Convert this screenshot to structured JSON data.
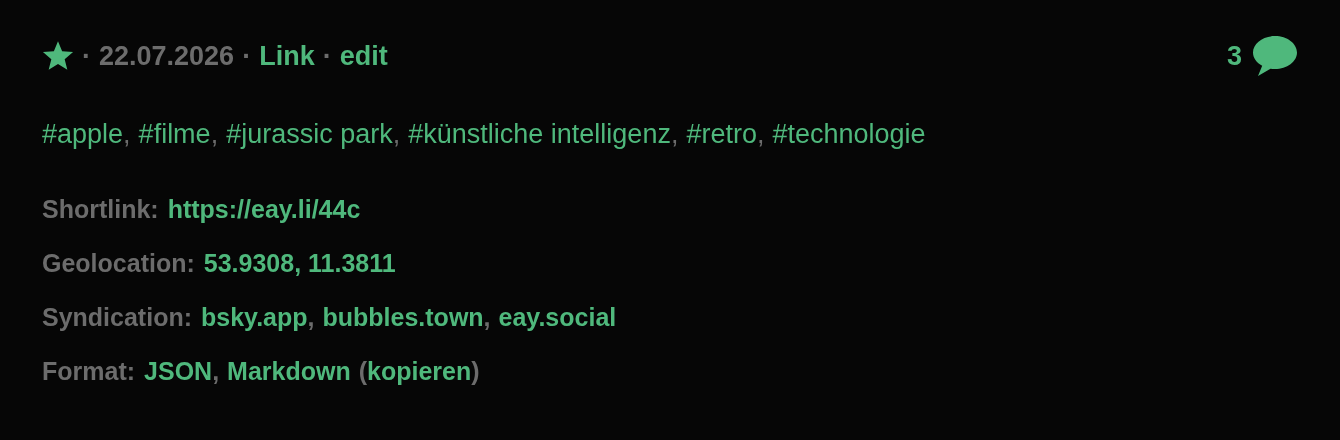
{
  "header": {
    "starred": true,
    "segments": [
      {
        "kind": "sep",
        "text": "·"
      },
      {
        "kind": "date",
        "text": "22.07.2026"
      },
      {
        "kind": "sep",
        "text": "·"
      },
      {
        "kind": "link",
        "text": "Link"
      },
      {
        "kind": "sep",
        "text": "·"
      },
      {
        "kind": "link",
        "text": "edit"
      }
    ],
    "comment_count": "3"
  },
  "tags": [
    {
      "kind": "link",
      "text": "#apple"
    },
    {
      "kind": "sep",
      "text": ","
    },
    {
      "kind": "link",
      "text": "#filme"
    },
    {
      "kind": "sep",
      "text": ","
    },
    {
      "kind": "link",
      "text": "#jurassic park"
    },
    {
      "kind": "sep",
      "text": ","
    },
    {
      "kind": "link",
      "text": "#künstliche intelligenz"
    },
    {
      "kind": "sep",
      "text": ","
    },
    {
      "kind": "link",
      "text": "#retro"
    },
    {
      "kind": "sep",
      "text": ","
    },
    {
      "kind": "link",
      "text": "#technologie"
    }
  ],
  "meta": [
    {
      "label": "Shortlink:",
      "values": [
        {
          "kind": "link",
          "text": "https://eay.li/44c"
        }
      ]
    },
    {
      "label": "Geolocation:",
      "values": [
        {
          "kind": "link",
          "text": "53.9308, 11.3811"
        }
      ]
    },
    {
      "label": "Syndication:",
      "values": [
        {
          "kind": "link",
          "text": "bsky.app"
        },
        {
          "kind": "sep",
          "text": ","
        },
        {
          "kind": "link",
          "text": "bubbles.town"
        },
        {
          "kind": "sep",
          "text": ","
        },
        {
          "kind": "link",
          "text": "eay.social"
        }
      ]
    },
    {
      "label": "Format:",
      "values": [
        {
          "kind": "link",
          "text": "JSON"
        },
        {
          "kind": "sep",
          "text": ","
        },
        {
          "kind": "link",
          "text": "Markdown"
        },
        {
          "kind": "open",
          "text": "("
        },
        {
          "kind": "link",
          "text": "kopieren"
        },
        {
          "kind": "close",
          "text": ")"
        }
      ]
    }
  ]
}
